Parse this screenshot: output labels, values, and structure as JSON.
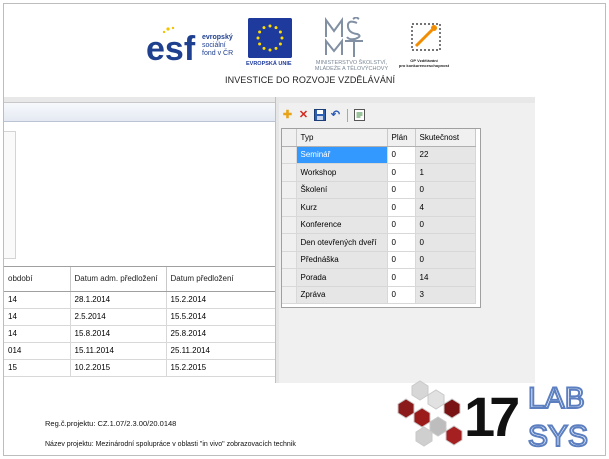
{
  "header": {
    "esf": {
      "line1": "evropský",
      "line2": "sociální",
      "line3": "fond v ČR"
    },
    "eu_label": "EVROPSKÁ UNIE",
    "msmt_label": {
      "line1": "MINISTERSTVO ŠKOLSTVÍ,",
      "line2": "MLÁDEŽE A TĚLOVÝCHOVY"
    },
    "op_label": {
      "line1": "OP Vzdělávání",
      "line2": "pro konkurenceschopnost"
    },
    "tagline": "INVESTICE DO ROZVOJE VZDĚLÁVÁNÍ"
  },
  "left_grid": {
    "columns": [
      "období",
      "Datum adm. předložení",
      "Datum předložení"
    ],
    "rows": [
      [
        "14",
        "28.1.2014",
        "15.2.2014"
      ],
      [
        "14",
        "2.5.2014",
        "15.5.2014"
      ],
      [
        "14",
        "15.8.2014",
        "25.8.2014"
      ],
      [
        "014",
        "15.11.2014",
        "25.11.2014"
      ],
      [
        "15",
        "10.2.2015",
        "15.2.2015"
      ]
    ]
  },
  "toolbar": {
    "icons": [
      "add-icon",
      "delete-icon",
      "save-icon",
      "undo-icon",
      "report-icon"
    ]
  },
  "right_grid": {
    "columns": [
      "Typ",
      "Plán",
      "Skutečnost"
    ],
    "rows": [
      [
        "Seminář",
        "0",
        "22"
      ],
      [
        "Workshop",
        "0",
        "1"
      ],
      [
        "Školení",
        "0",
        "0"
      ],
      [
        "Kurz",
        "0",
        "4"
      ],
      [
        "Konference",
        "0",
        "0"
      ],
      [
        "Den otevřených dveří",
        "0",
        "0"
      ],
      [
        "Přednáška",
        "0",
        "0"
      ],
      [
        "Porada",
        "0",
        "14"
      ],
      [
        "Zpráva",
        "0",
        "3"
      ]
    ],
    "selected_row": 0
  },
  "footer": {
    "reg": "Reg.č.projektu: CZ.1.07/2.3.00/20.0148",
    "project": "Název projektu: Mezinárodní spolupráce v oblasti \"in vivo\" zobrazovacích technik"
  },
  "lab_logo": {
    "text_top": "LAB",
    "text_bottom": "SYS",
    "number": "17"
  },
  "colors": {
    "selection": "#3399ff",
    "esf_blue": "#1f3f8f",
    "eu_blue": "#1d3a9c",
    "lab_red": "#8b1a1a",
    "lab_blue": "#5b7fc0"
  }
}
